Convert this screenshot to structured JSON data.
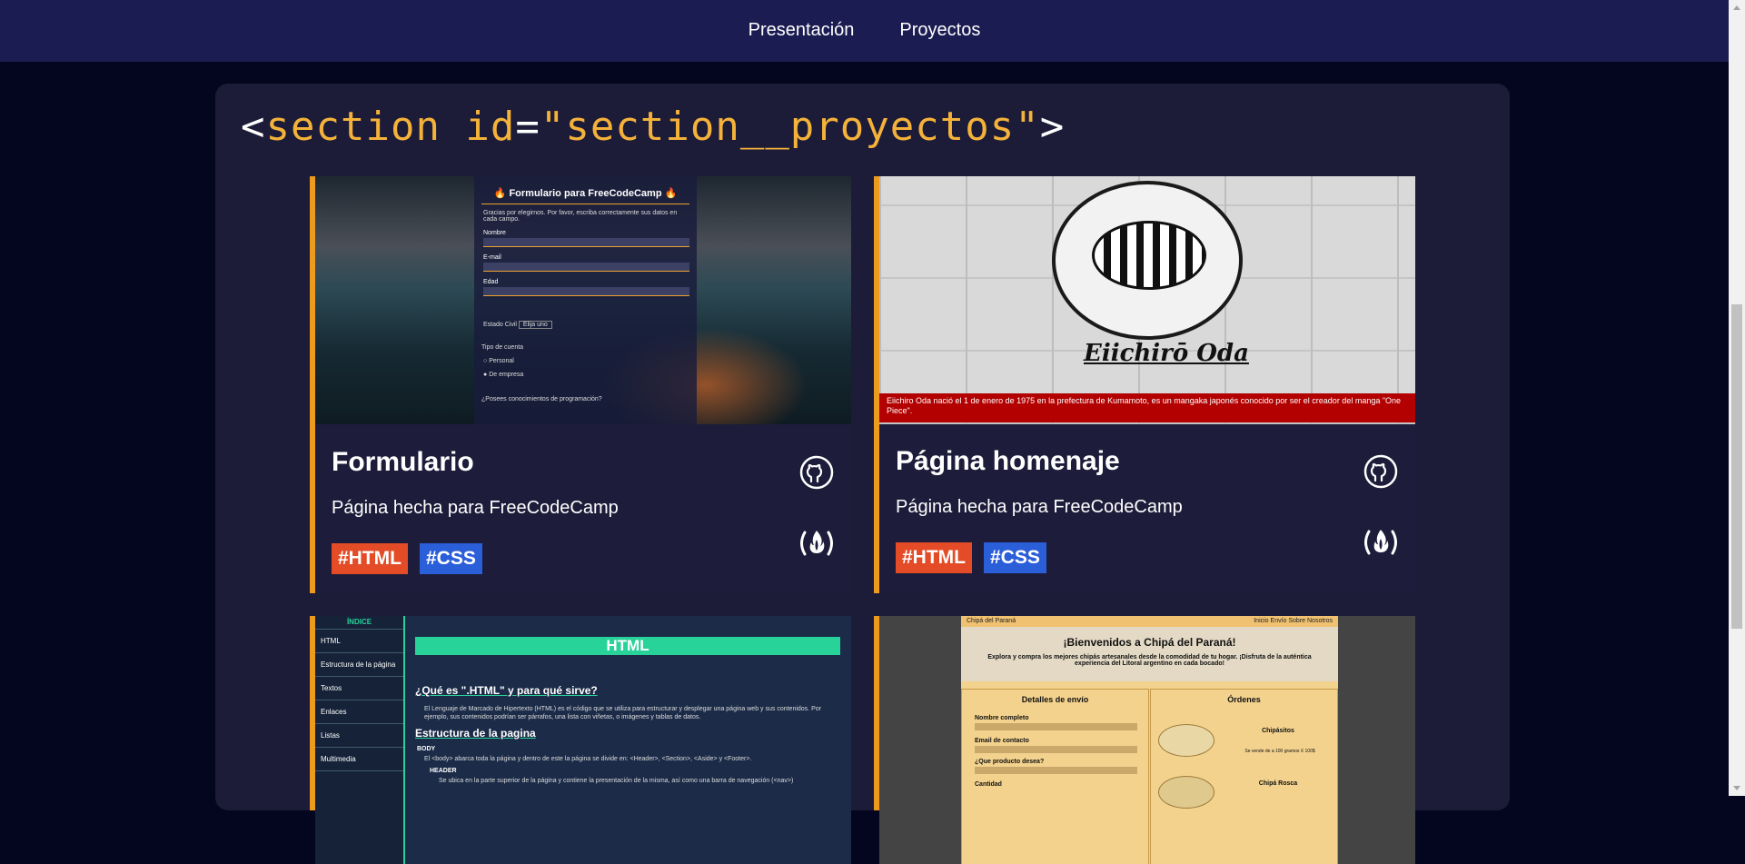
{
  "nav": {
    "items": [
      "Presentación",
      "Proyectos"
    ]
  },
  "section": {
    "title_parts": [
      "<",
      "section ",
      "id",
      "=",
      "\"section__proyectos\"",
      ">"
    ]
  },
  "projects": [
    {
      "title": "Formulario",
      "description": "Página hecha para FreeCodeCamp",
      "tags": [
        "#HTML",
        "#CSS"
      ],
      "preview": {
        "title": "🔥 Formulario para FreeCodeCamp 🔥",
        "intro": "Gracias por elegirnos. Por favor, escriba correctamente sus datos en cada campo.",
        "fields": [
          "Nombre",
          "E-mail",
          "Edad"
        ],
        "estado_civil": "Estado Civil",
        "select_value": "Elija uno",
        "tipo_cuenta": "Tipo de cuenta",
        "radios": [
          "Personal",
          "De empresa"
        ],
        "question": "¿Posees conocimientos de programación?"
      }
    },
    {
      "title": "Página homenaje",
      "description": "Página hecha para FreeCodeCamp",
      "tags": [
        "#HTML",
        "#CSS"
      ],
      "preview": {
        "name": "Eiichirō Oda",
        "caption": "Eiichiro Oda nació el 1 de enero de 1975 en la prefectura de Kumamoto, es un mangaka japonés conocido por ser el creador del manga \"One Piece\"."
      }
    },
    {
      "preview": {
        "index_title": "ÍNDICE",
        "index_items": [
          "HTML",
          "Estructura de la página",
          "Textos",
          "Enlaces",
          "Listas",
          "Multimedia"
        ],
        "banner": "HTML",
        "h1": "¿Qué es \".HTML\" y para qué sirve?",
        "p1": "El Lenguaje de Marcado de Hipertexto (HTML) es el código que se utiliza para estructurar y desplegar una página web y sus contenidos. Por ejemplo, sus contenidos podrían ser párrafos, una lista con viñetas, o imágenes y tablas de datos.",
        "h2": "Estructura de la pagina",
        "body_label": "BODY",
        "p2": "El <body> abarca toda la página y dentro de este la página se divide en: <Header>, <Section>, <Aside> y <Footer>.",
        "header_label": "HEADER",
        "p3": "Se ubica en la parte superior de la página y contiene la presentación de la misma, así como una barra de navegación (<nav>)"
      }
    },
    {
      "preview": {
        "brand": "Chipá del Paraná",
        "menu": "Inicio  Envío  Sobre Nosotros",
        "hero_title": "¡Bienvenidos a Chipá del Paraná!",
        "hero_sub": "Explora y compra los mejores chipás artesanales desde la comodidad de tu hogar. ¡Disfruta de la auténtica experiencia del Litoral argentino en cada bocado!",
        "col1_title": "Detalles de envío",
        "col1_fields": [
          "Nombre completo",
          "Email de contacto",
          "¿Que producto desea?",
          "Cantidad"
        ],
        "col2_title": "Órdenes",
        "items": [
          {
            "name": "Chipásitos",
            "detail": "Se vende de a 100 gramos X 100$"
          },
          {
            "name": "Chipá Rosca",
            "detail": ""
          }
        ]
      }
    }
  ],
  "colors": {
    "accent": "#ee9a1c",
    "html_tag": "#e34c26",
    "css_tag": "#2b5ed9",
    "nav_bg": "#1b1c52"
  },
  "icons": [
    "github-icon",
    "freecodecamp-icon"
  ]
}
